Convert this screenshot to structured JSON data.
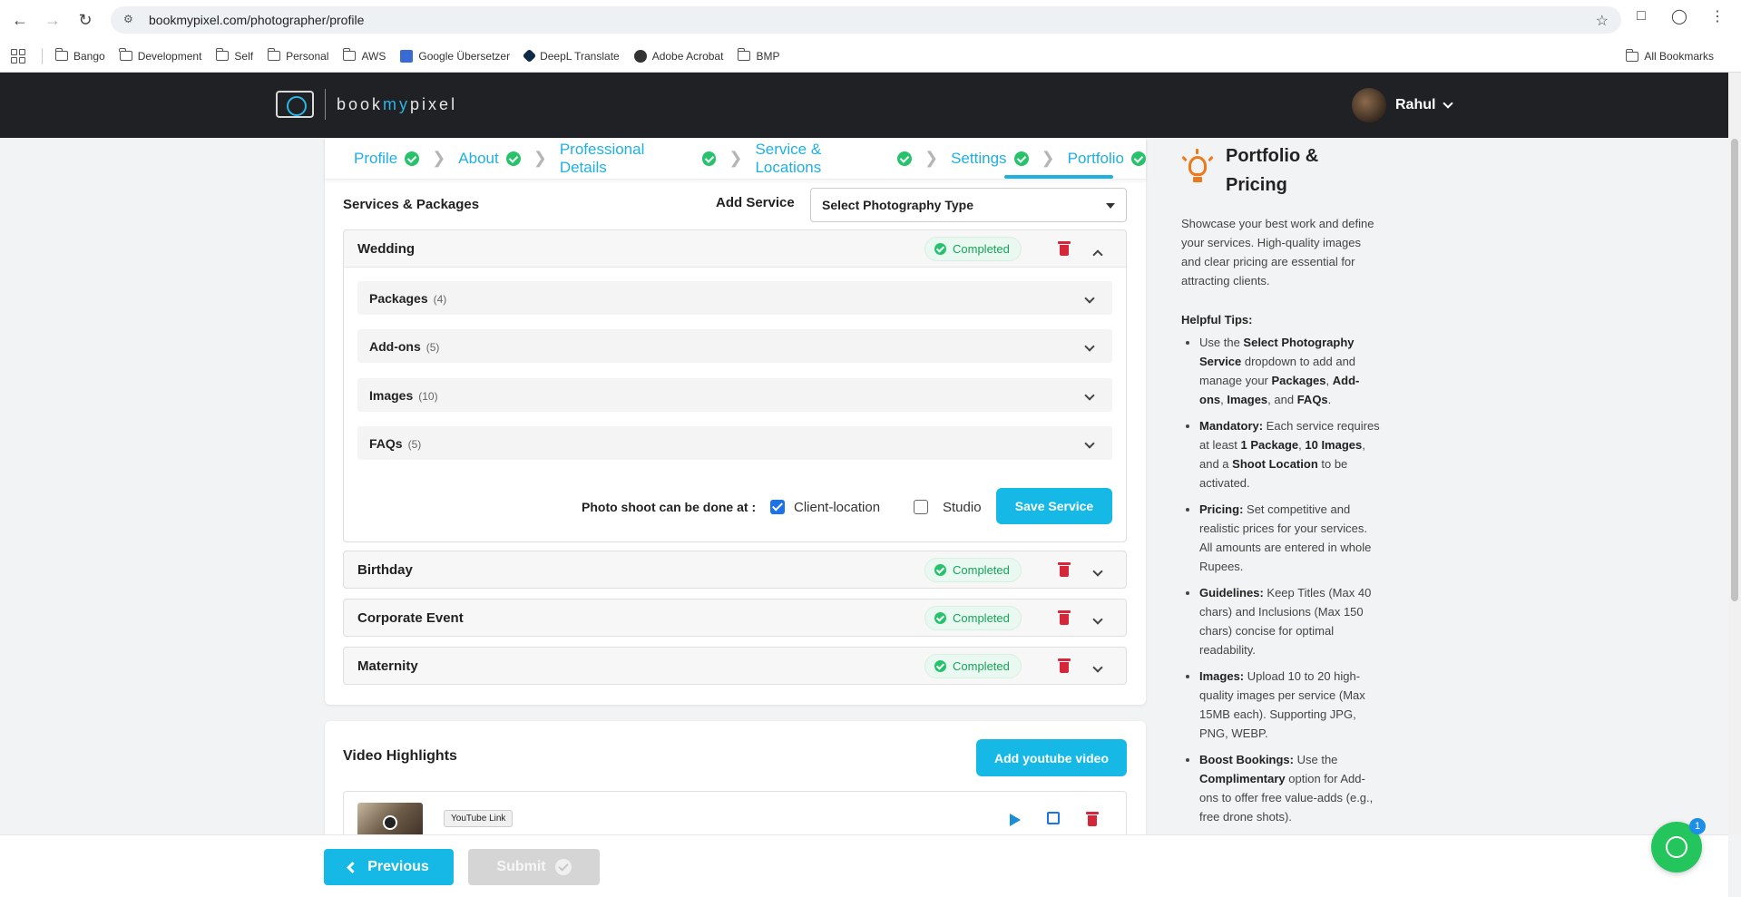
{
  "browser": {
    "url": "bookmypixel.com/photographer/profile",
    "bookmarks": [
      "Bango",
      "Development",
      "Self",
      "Personal",
      "AWS",
      "Google Übersetzer",
      "DeepL Translate",
      "Adobe Acrobat",
      "BMP"
    ],
    "all_bookmarks": "All Bookmarks"
  },
  "header": {
    "logo_pre": "book",
    "logo_my": "my",
    "logo_post": "pixel",
    "user_name": "Rahul"
  },
  "stepper": {
    "steps": [
      "Profile",
      "About",
      "Professional Details",
      "Service & Locations",
      "Settings",
      "Portfolio"
    ],
    "active": "Portfolio"
  },
  "services": {
    "title": "Services & Packages",
    "add_label": "Add Service",
    "select_value": "Select Photography Type",
    "status_label": "Completed",
    "items": [
      {
        "name": "Wedding",
        "expanded": true,
        "sections": [
          {
            "label": "Packages",
            "count": "(4)"
          },
          {
            "label": "Add-ons",
            "count": "(5)"
          },
          {
            "label": "Images",
            "count": "(10)"
          },
          {
            "label": "FAQs",
            "count": "(5)"
          }
        ],
        "shoot_label": "Photo shoot can be done at :",
        "client_location_label": "Client-location",
        "client_location_checked": true,
        "studio_label": "Studio",
        "studio_checked": false,
        "save_label": "Save Service"
      },
      {
        "name": "Birthday"
      },
      {
        "name": "Corporate Event"
      },
      {
        "name": "Maternity"
      }
    ]
  },
  "video": {
    "title": "Video Highlights",
    "add_label": "Add youtube video",
    "tag": "YouTube Link"
  },
  "footer": {
    "previous_label": "Previous",
    "submit_label": "Submit"
  },
  "tips": {
    "title_line1": "Portfolio &",
    "title_line2": "Pricing",
    "intro": "Showcase your best work and define your services. High-quality images and clear pricing are essential for attracting clients.",
    "helpful": "Helpful Tips:",
    "t1_a": "Use the ",
    "t1_b": "Select Photography Service",
    "t1_c": " dropdown to add and manage your ",
    "t1_d": "Packages",
    "t1_e": ", ",
    "t1_f": "Add-ons",
    "t1_g": ", ",
    "t1_h": "Images",
    "t1_i": ", and ",
    "t1_j": "FAQs",
    "t1_k": ".",
    "t2_a": "Mandatory:",
    "t2_b": " Each service requires at least ",
    "t2_c": "1 Package",
    "t2_d": ", ",
    "t2_e": "10 Images",
    "t2_f": ", and a ",
    "t2_g": "Shoot Location",
    "t2_h": " to be activated.",
    "t3_a": "Pricing:",
    "t3_b": " Set competitive and realistic prices for your services. All amounts are entered in whole Rupees.",
    "t4_a": "Guidelines:",
    "t4_b": " Keep Titles (Max 40 chars) and Inclusions (Max 150 chars) concise for optimal readability.",
    "t5_a": "Images:",
    "t5_b": " Upload 10 to 20 high-quality images per service (Max 15MB each). Supporting JPG, PNG, WEBP.",
    "t6_a": "Boost Bookings:",
    "t6_b": " Use the ",
    "t6_c": "Complimentary",
    "t6_d": " option for Add-ons to offer free value-adds (e.g., free drone shots)."
  },
  "whatsapp_badge": "1",
  "icons": {
    "back": "arrow-left-icon",
    "forward": "arrow-right-icon",
    "reload": "reload-icon",
    "delete": "trash-icon",
    "status": "check-circle-icon",
    "chat": "whatsapp-icon"
  },
  "colors": {
    "accent": "#16b9e6",
    "header_bg": "#1f2124",
    "success": "#27c26c",
    "danger": "#d6263a"
  }
}
